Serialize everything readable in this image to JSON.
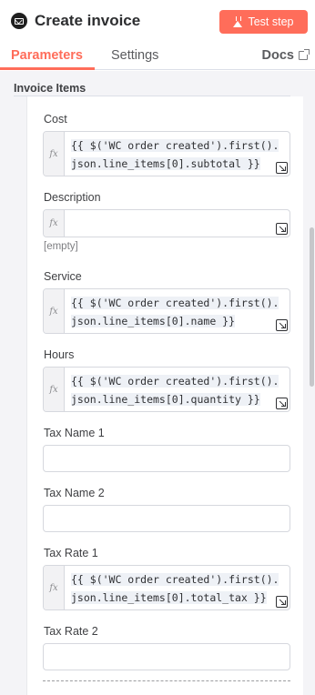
{
  "header": {
    "title": "Create invoice",
    "node_icon": "envelope-icon",
    "test_button_label": "Test step",
    "test_button_icon": "flask-icon",
    "accent_color": "#ff6d5a"
  },
  "tabs": {
    "items": [
      {
        "label": "Parameters",
        "active": true
      },
      {
        "label": "Settings",
        "active": false
      }
    ],
    "docs_label": "Docs",
    "docs_icon": "external-link-icon"
  },
  "section": {
    "title": "Invoice Items"
  },
  "fields": {
    "cost": {
      "label": "Cost",
      "line1": "{{ $('WC order created').first().",
      "line2": "json.line_items[0].subtotal }}"
    },
    "description": {
      "label": "Description",
      "hint": "[empty]"
    },
    "service": {
      "label": "Service",
      "line1": "{{ $('WC order created').first().",
      "line2": "json.line_items[0].name }}"
    },
    "hours": {
      "label": "Hours",
      "line1": "{{ $('WC order created').first().",
      "line2": "json.line_items[0].quantity }}"
    },
    "tax_name_1": {
      "label": "Tax Name 1",
      "value": ""
    },
    "tax_name_2": {
      "label": "Tax Name 2",
      "value": ""
    },
    "tax_rate_1": {
      "label": "Tax Rate 1",
      "line1": "{{ $('WC order created').first().",
      "line2": "json.line_items[0].total_tax }}"
    },
    "tax_rate_2": {
      "label": "Tax Rate 2",
      "value": ""
    }
  },
  "fx_label": "fx"
}
